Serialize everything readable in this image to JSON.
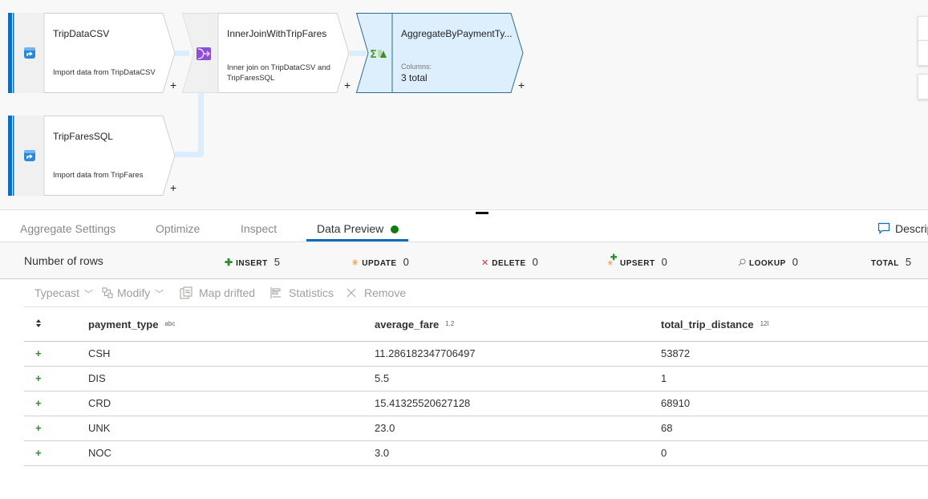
{
  "canvas": {
    "nodes": [
      {
        "id": "tripdatacsv",
        "type": "source",
        "title": "TripDataCSV",
        "description": "Import data from TripDataCSV",
        "icon": "source-icon",
        "add_label": "+"
      },
      {
        "id": "innerjoin",
        "type": "join",
        "title": "InnerJoinWithTripFares",
        "description": "Inner join on TripDataCSV and TripFaresSQL",
        "icon": "join-icon",
        "add_label": "+"
      },
      {
        "id": "aggregate",
        "type": "aggregate",
        "title": "AggregateByPaymentTy...",
        "meta_label": "Columns:",
        "meta_value": "3 total",
        "icon": "aggregate-icon",
        "add_label": "+",
        "selected": true
      },
      {
        "id": "tripfaressql",
        "type": "source",
        "title": "TripFaresSQL",
        "description": "Import data from TripFares",
        "icon": "source-icon",
        "add_label": "+"
      }
    ]
  },
  "tabs": [
    {
      "label": "Aggregate Settings",
      "active": false
    },
    {
      "label": "Optimize",
      "active": false
    },
    {
      "label": "Inspect",
      "active": false
    },
    {
      "label": "Data Preview",
      "active": true,
      "status": "success"
    }
  ],
  "description_link": "Descrip",
  "stats": {
    "rows_label": "Number of rows",
    "items": [
      {
        "label": "INSERT",
        "value": "5",
        "icon": "insert-icon"
      },
      {
        "label": "UPDATE",
        "value": "0",
        "icon": "update-icon"
      },
      {
        "label": "DELETE",
        "value": "0",
        "icon": "delete-icon"
      },
      {
        "label": "UPSERT",
        "value": "0",
        "icon": "upsert-icon"
      },
      {
        "label": "LOOKUP",
        "value": "0",
        "icon": "lookup-icon"
      },
      {
        "label": "TOTAL",
        "value": "5"
      }
    ]
  },
  "toolbar": {
    "typecast": "Typecast",
    "modify": "Modify",
    "map_drifted": "Map drifted",
    "statistics": "Statistics",
    "remove": "Remove"
  },
  "grid": {
    "columns": [
      {
        "name": "payment_type",
        "type_badge": "abc"
      },
      {
        "name": "average_fare",
        "type_badge": "1.2"
      },
      {
        "name": "total_trip_distance",
        "type_badge": "12l"
      }
    ],
    "rows": [
      {
        "marker": "+",
        "cells": [
          "CSH",
          "11.286182347706497",
          "53872"
        ]
      },
      {
        "marker": "+",
        "cells": [
          "DIS",
          "5.5",
          "1"
        ]
      },
      {
        "marker": "+",
        "cells": [
          "CRD",
          "15.41325520627128",
          "68910"
        ]
      },
      {
        "marker": "+",
        "cells": [
          "UNK",
          "23.0",
          "68"
        ]
      },
      {
        "marker": "+",
        "cells": [
          "NOC",
          "3.0",
          "0"
        ]
      }
    ]
  },
  "colors": {
    "accent": "#0f6cbd",
    "success": "#107c10",
    "insert": "#2e8b2e",
    "update": "#d68a1e",
    "delete": "#d13438",
    "selected_node_fill": "#ddeefc"
  }
}
